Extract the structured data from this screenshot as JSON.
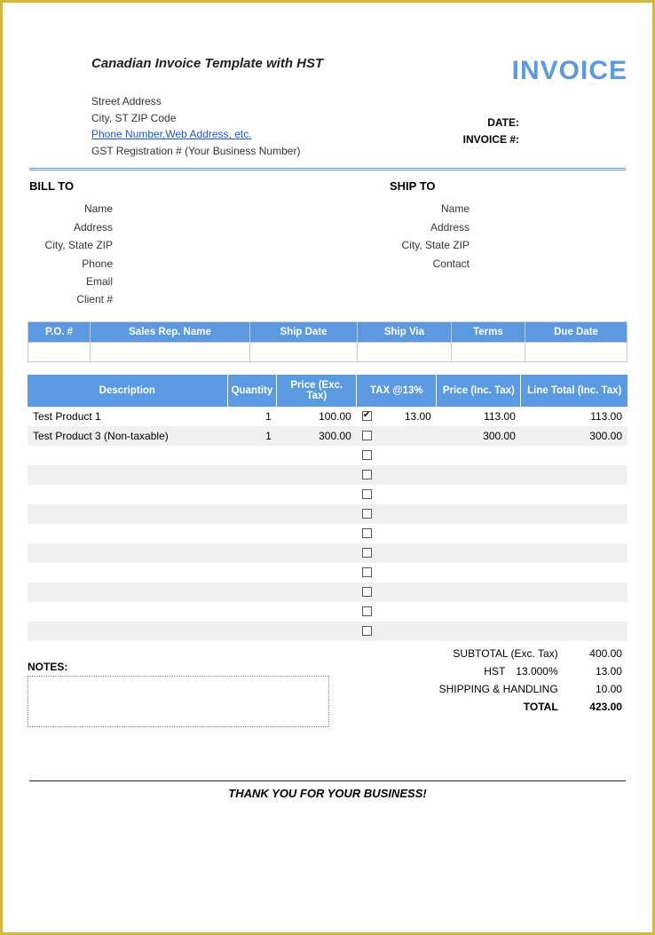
{
  "header": {
    "title": "Canadian Invoice Template with HST",
    "invoice_word": "INVOICE",
    "from": {
      "street": "Street Address",
      "city_line": "City, ST  ZIP Code",
      "contact": "Phone Number,Web Address, etc.",
      "gst": "GST Registration # (Your Business Number)"
    },
    "meta_labels": {
      "date": "DATE:",
      "invoice_no": "INVOICE #:"
    }
  },
  "bill_to": {
    "heading": "BILL TO",
    "fields": {
      "name": "Name",
      "address": "Address",
      "csz": "City, State ZIP",
      "phone": "Phone",
      "email": "Email",
      "client": "Client #"
    }
  },
  "ship_to": {
    "heading": "SHIP TO",
    "fields": {
      "name": "Name",
      "address": "Address",
      "csz": "City, State ZIP",
      "contact": "Contact"
    }
  },
  "meta_cols": [
    "P.O. #",
    "Sales Rep. Name",
    "Ship Date",
    "Ship Via",
    "Terms",
    "Due Date"
  ],
  "item_cols": [
    "Description",
    "Quantity",
    "Price (Exc. Tax)",
    "TAX @13%",
    "Price (Inc. Tax)",
    "Line Total (Inc. Tax)"
  ],
  "items": [
    {
      "desc": "Test Product 1",
      "qty": "1",
      "price": "100.00",
      "taxed": true,
      "tax": "13.00",
      "inc": "113.00",
      "total": "113.00"
    },
    {
      "desc": "Test Product 3 (Non-taxable)",
      "qty": "1",
      "price": "300.00",
      "taxed": false,
      "tax": "",
      "inc": "300.00",
      "total": "300.00"
    },
    {
      "desc": "",
      "qty": "",
      "price": "",
      "taxed": false,
      "tax": "",
      "inc": "",
      "total": ""
    },
    {
      "desc": "",
      "qty": "",
      "price": "",
      "taxed": false,
      "tax": "",
      "inc": "",
      "total": ""
    },
    {
      "desc": "",
      "qty": "",
      "price": "",
      "taxed": false,
      "tax": "",
      "inc": "",
      "total": ""
    },
    {
      "desc": "",
      "qty": "",
      "price": "",
      "taxed": false,
      "tax": "",
      "inc": "",
      "total": ""
    },
    {
      "desc": "",
      "qty": "",
      "price": "",
      "taxed": false,
      "tax": "",
      "inc": "",
      "total": ""
    },
    {
      "desc": "",
      "qty": "",
      "price": "",
      "taxed": false,
      "tax": "",
      "inc": "",
      "total": ""
    },
    {
      "desc": "",
      "qty": "",
      "price": "",
      "taxed": false,
      "tax": "",
      "inc": "",
      "total": ""
    },
    {
      "desc": "",
      "qty": "",
      "price": "",
      "taxed": false,
      "tax": "",
      "inc": "",
      "total": ""
    },
    {
      "desc": "",
      "qty": "",
      "price": "",
      "taxed": false,
      "tax": "",
      "inc": "",
      "total": ""
    },
    {
      "desc": "",
      "qty": "",
      "price": "",
      "taxed": false,
      "tax": "",
      "inc": "",
      "total": ""
    }
  ],
  "notes_label": "NOTES:",
  "totals": {
    "subtotal_label": "SUBTOTAL (Exc. Tax)",
    "subtotal": "400.00",
    "hst_label": "HST",
    "hst_rate": "13.000%",
    "hst": "13.00",
    "ship_label": "SHIPPING & HANDLING",
    "ship": "10.00",
    "total_label": "TOTAL",
    "total": "423.00"
  },
  "thankyou": "THANK YOU FOR YOUR BUSINESS!"
}
